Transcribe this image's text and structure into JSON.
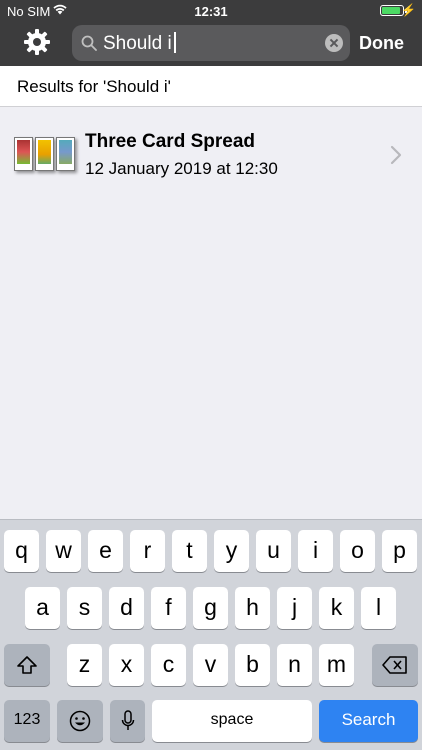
{
  "status_bar": {
    "carrier": "No SIM",
    "time": "12:31",
    "battery_level": 0.9,
    "battery_color": "#4cd964"
  },
  "nav_bar": {
    "settings_icon": "gear-icon",
    "search": {
      "query": "Should i",
      "search_icon": "magnifier-icon",
      "clear_icon": "clear-icon"
    },
    "done_label": "Done",
    "background": "#3c3c3d"
  },
  "results": {
    "header": "Results for 'Should i'",
    "items": [
      {
        "title": "Three Card Spread",
        "date": "12 January 2019 at 12:30",
        "thumbnail": "tarot-cards-icon"
      }
    ]
  },
  "keyboard": {
    "row1": [
      "q",
      "w",
      "e",
      "r",
      "t",
      "y",
      "u",
      "i",
      "o",
      "p"
    ],
    "row2": [
      "a",
      "s",
      "d",
      "f",
      "g",
      "h",
      "j",
      "k",
      "l"
    ],
    "row3": [
      "z",
      "x",
      "c",
      "v",
      "b",
      "n",
      "m"
    ],
    "numbers_label": "123",
    "space_label": "space",
    "search_label": "Search",
    "search_color": "#2e83f2"
  }
}
